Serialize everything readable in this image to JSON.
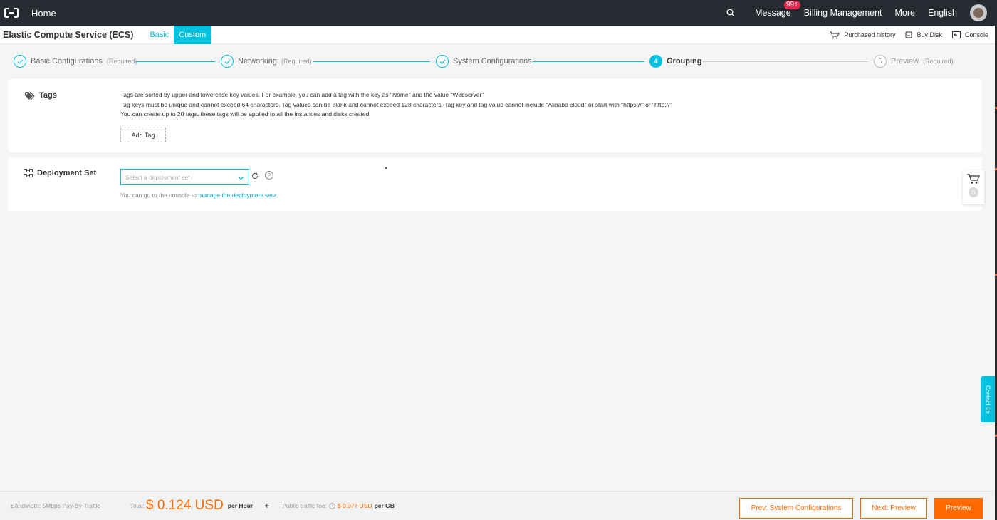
{
  "topbar": {
    "home": "Home",
    "message": "Message",
    "message_badge": "99+",
    "billing": "Billing Management",
    "more": "More",
    "language": "English"
  },
  "subbar": {
    "product": "Elastic Compute Service (ECS)",
    "tab_basic": "Basic",
    "tab_custom": "Custom",
    "purchased_history": "Purchased history",
    "buy_disk": "Buy Disk",
    "console": "Console"
  },
  "steps": [
    {
      "name": "Basic Configurations",
      "req": "(Required)",
      "state": "done"
    },
    {
      "name": "Networking",
      "req": "(Required)",
      "state": "done"
    },
    {
      "name": "System Configurations",
      "req": "",
      "state": "done"
    },
    {
      "name": "Grouping",
      "req": "",
      "state": "active",
      "num": "4"
    },
    {
      "name": "Preview",
      "req": "(Required)",
      "state": "pending",
      "num": "5"
    }
  ],
  "tags": {
    "title": "Tags",
    "line1": "Tags are sorted by upper and lowercase key values. For example, you can add a tag with the key as \"Name\" and the value \"Webserver\"",
    "line2": "Tag keys must be unique and cannot exceed 64 characters. Tag values can be blank and cannot exceed 128 characters. Tag key and tag value cannot include \"Alibaba cloud\" or start with \"https://\" or \"http://\"",
    "line3": "You can create up to 20 tags, these tags will be applied to all the instances and disks created.",
    "add_tag": "Add Tag"
  },
  "deployment": {
    "title": "Deployment Set",
    "placeholder": "Select a deployment set",
    "hint": "You can go to the console to ",
    "hint_link": "manage the deployment set>."
  },
  "cart": {
    "count": "0"
  },
  "contact": "Contact Us",
  "bottom": {
    "bandwidth": "Bandwidth: 5Mbps Pay-By-Traffic",
    "total_label": "Total:",
    "total_amount": "$ 0.124 USD",
    "per": "per Hour",
    "plus": "+",
    "traffic_label": "Public traffic fee:",
    "traffic_amount": "$ 0.077 USD",
    "traffic_unit": "per GB",
    "prev_btn": "Prev: System Configurations",
    "next_btn": "Next: Preview",
    "preview_btn": "Preview"
  },
  "colors": {
    "accent": "#00c1de",
    "orange": "#ff6a00",
    "topbar": "#262a31"
  }
}
